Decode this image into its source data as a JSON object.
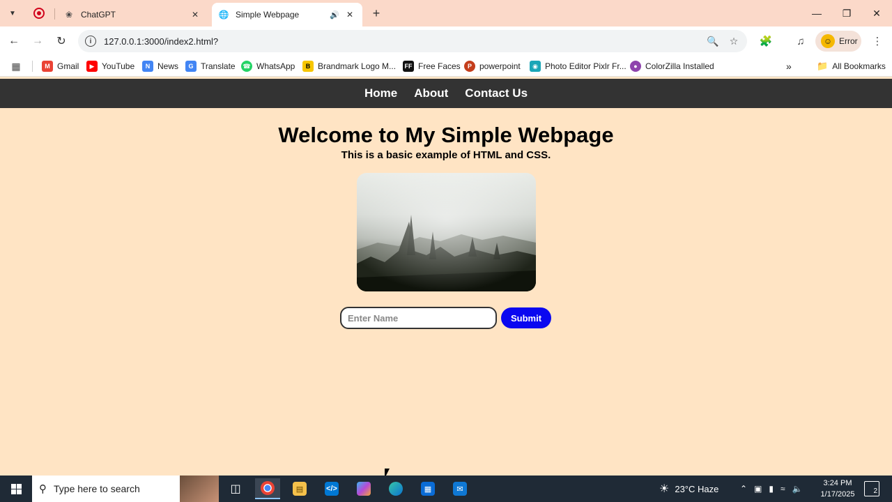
{
  "browser": {
    "tabs": [
      {
        "title": "ChatGPT",
        "icon": "chatgpt-icon"
      },
      {
        "title": "Simple Webpage",
        "icon": "globe-icon",
        "active": true
      }
    ],
    "url": "127.0.0.1:3000/index2.html?",
    "profile_label": "Error",
    "bookmarks": [
      {
        "label": "Gmail",
        "icon": "gmail-icon",
        "color": "#ea4335"
      },
      {
        "label": "YouTube",
        "icon": "youtube-icon",
        "color": "#ff0000"
      },
      {
        "label": "News",
        "icon": "news-icon",
        "color": "#4285f4"
      },
      {
        "label": "Translate",
        "icon": "translate-icon",
        "color": "#4285f4"
      },
      {
        "label": "WhatsApp",
        "icon": "whatsapp-icon",
        "color": "#25d366"
      },
      {
        "label": "Brandmark Logo M...",
        "icon": "brandmark-icon",
        "color": "#f7c600"
      },
      {
        "label": "Free Faces",
        "icon": "freefaces-icon",
        "color": "#111111"
      },
      {
        "label": "powerpoint",
        "icon": "powerpoint-icon",
        "color": "#c43e1c"
      },
      {
        "label": "Photo Editor Pixlr Fr...",
        "icon": "pixlr-icon",
        "color": "#1aa6b7"
      },
      {
        "label": "ColorZilla Installed",
        "icon": "colorzilla-icon",
        "color": "#8e44ad"
      }
    ],
    "all_bookmarks_label": "All Bookmarks"
  },
  "page": {
    "nav": [
      "Home",
      "About",
      "Contact Us"
    ],
    "heading": "Welcome to My Simple Webpage",
    "subheading": "This is a basic example of HTML and CSS.",
    "name_placeholder": "Enter Name",
    "submit_label": "Submit"
  },
  "taskbar": {
    "search_placeholder": "Type here to search",
    "weather": "23°C  Haze",
    "time": "3:24 PM",
    "date": "1/17/2025",
    "notification_count": "2"
  },
  "colors": {
    "page_bg": "#ffe4c4",
    "nav_bg": "#333333",
    "submit_bg": "#0a08f0"
  }
}
